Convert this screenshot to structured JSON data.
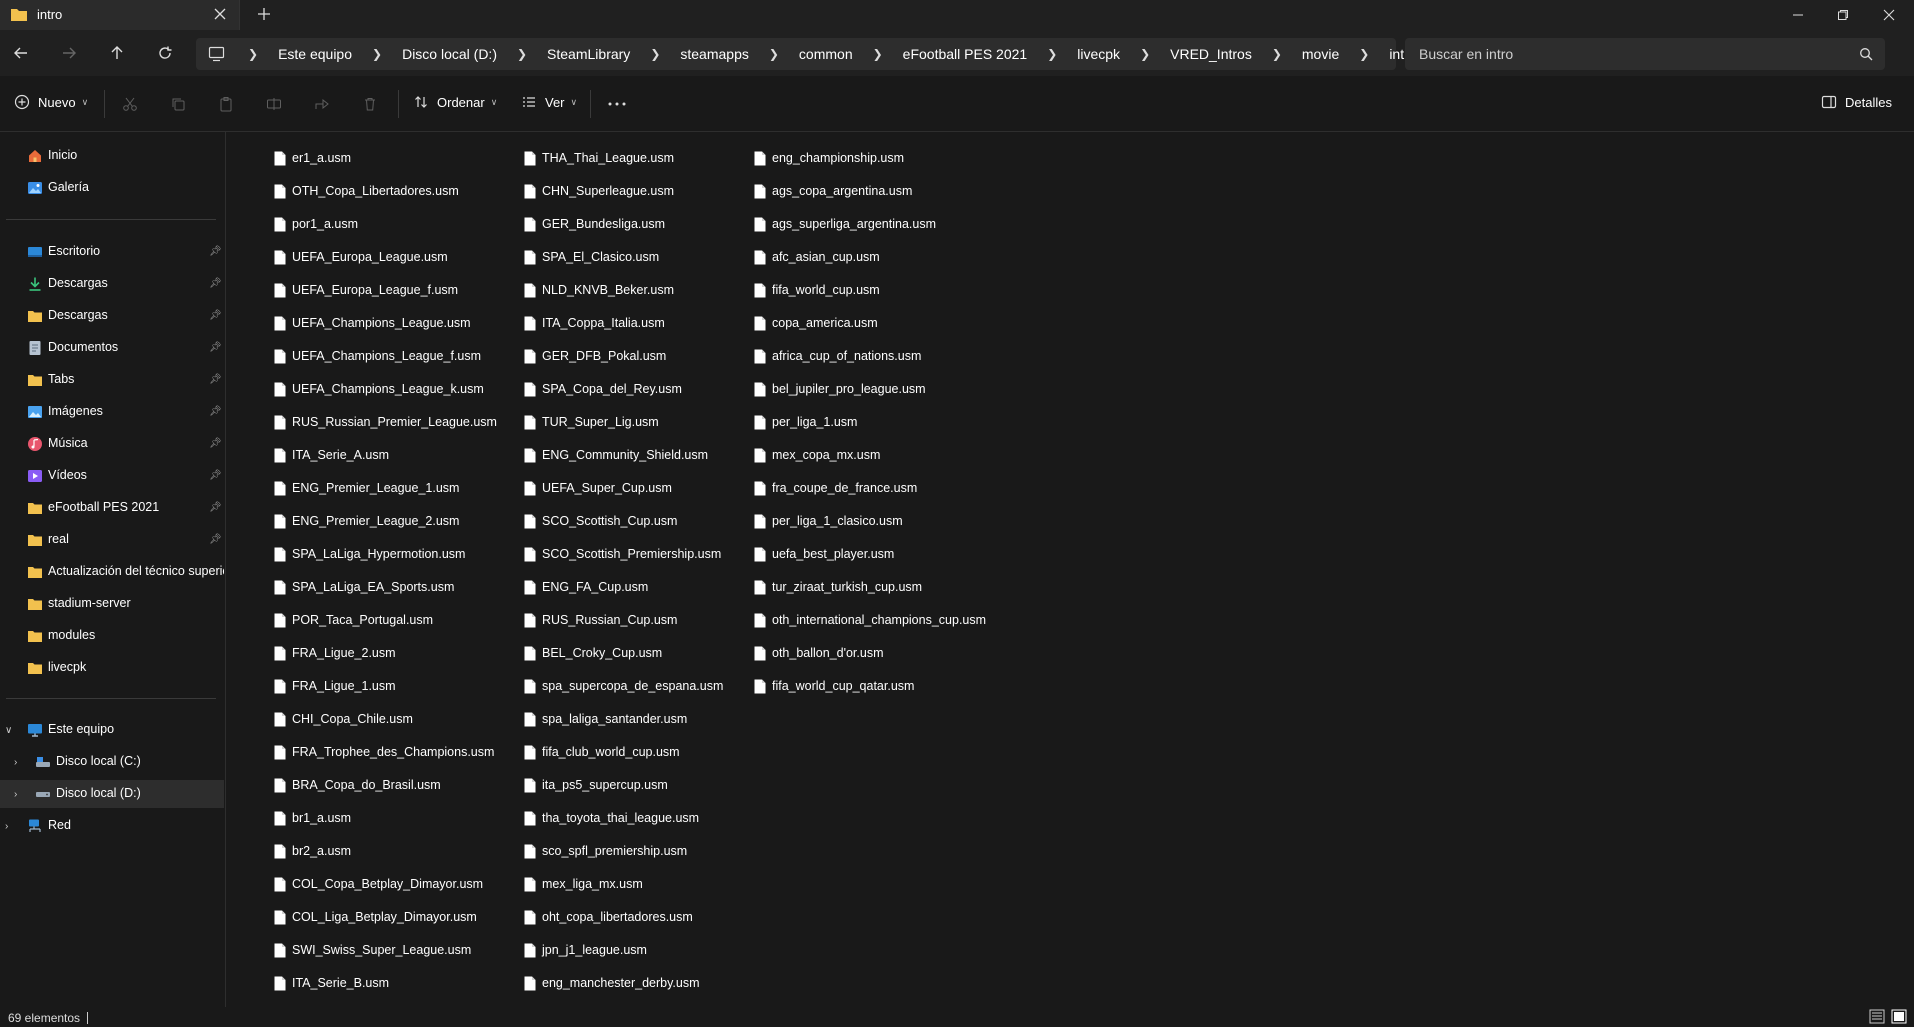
{
  "window": {
    "tab_title": "intro"
  },
  "address": {
    "breadcrumbs": [
      "Este equipo",
      "Disco local (D:)",
      "SteamLibrary",
      "steamapps",
      "common",
      "eFootball PES 2021",
      "livecpk",
      "VRED_Intros",
      "movie",
      "intro"
    ],
    "search_placeholder": "Buscar en intro"
  },
  "toolbar": {
    "new_label": "Nuevo",
    "sort_label": "Ordenar",
    "view_label": "Ver",
    "details_label": "Detalles"
  },
  "sidebar": {
    "home": "Inicio",
    "gallery": "Galería",
    "pinned": [
      "Escritorio",
      "Descargas",
      "Descargas",
      "Documentos",
      "Tabs",
      "Imágenes",
      "Música",
      "Vídeos",
      "eFootball PES 2021",
      "real"
    ],
    "recent": [
      "Actualización del técnico superio",
      "stadium-server",
      "modules",
      "livecpk"
    ],
    "this_pc": "Este equipo",
    "drive_c": "Disco local (C:)",
    "drive_d": "Disco local (D:)",
    "network": "Red"
  },
  "files": {
    "column1": [
      "er1_a.usm",
      "OTH_Copa_Libertadores.usm",
      "por1_a.usm",
      "UEFA_Europa_League.usm",
      "UEFA_Europa_League_f.usm",
      "UEFA_Champions_League.usm",
      "UEFA_Champions_League_f.usm",
      "UEFA_Champions_League_k.usm",
      "RUS_Russian_Premier_League.usm",
      "ITA_Serie_A.usm",
      "ENG_Premier_League_1.usm",
      "ENG_Premier_League_2.usm",
      "SPA_LaLiga_Hypermotion.usm",
      "SPA_LaLiga_EA_Sports.usm",
      "POR_Taca_Portugal.usm",
      "FRA_Ligue_2.usm",
      "FRA_Ligue_1.usm",
      "CHI_Copa_Chile.usm",
      "FRA_Trophee_des_Champions.usm",
      "BRA_Copa_do_Brasil.usm",
      "br1_a.usm",
      "br2_a.usm",
      "COL_Copa_Betplay_Dimayor.usm",
      "COL_Liga_Betplay_Dimayor.usm",
      "SWI_Swiss_Super_League.usm",
      "ITA_Serie_B.usm"
    ],
    "column2": [
      "THA_Thai_League.usm",
      "CHN_Superleague.usm",
      "GER_Bundesliga.usm",
      "SPA_El_Clasico.usm",
      "NLD_KNVB_Beker.usm",
      "ITA_Coppa_Italia.usm",
      "GER_DFB_Pokal.usm",
      "SPA_Copa_del_Rey.usm",
      "TUR_Super_Lig.usm",
      "ENG_Community_Shield.usm",
      "UEFA_Super_Cup.usm",
      "SCO_Scottish_Cup.usm",
      "SCO_Scottish_Premiership.usm",
      "ENG_FA_Cup.usm",
      "RUS_Russian_Cup.usm",
      "BEL_Croky_Cup.usm",
      "spa_supercopa_de_espana.usm",
      "spa_laliga_santander.usm",
      "fifa_club_world_cup.usm",
      "ita_ps5_supercup.usm",
      "tha_toyota_thai_league.usm",
      "sco_spfl_premiership.usm",
      "mex_liga_mx.usm",
      "oht_copa_libertadores.usm",
      "jpn_j1_league.usm",
      "eng_manchester_derby.usm"
    ],
    "column3": [
      "eng_championship.usm",
      "ags_copa_argentina.usm",
      "ags_superliga_argentina.usm",
      "afc_asian_cup.usm",
      "fifa_world_cup.usm",
      "copa_america.usm",
      "africa_cup_of_nations.usm",
      "bel_jupiler_pro_league.usm",
      "per_liga_1.usm",
      "mex_copa_mx.usm",
      "fra_coupe_de_france.usm",
      "per_liga_1_clasico.usm",
      "uefa_best_player.usm",
      "tur_ziraat_turkish_cup.usm",
      "oth_international_champions_cup.usm",
      "oth_ballon_d'or.usm",
      "fifa_world_cup_qatar.usm"
    ]
  },
  "status": {
    "count_text": "69 elementos"
  },
  "colors": {
    "background": "#191919",
    "chrome": "#202020",
    "field": "#2d2d2d",
    "folder": "#f2c14e",
    "selection": "#2d2d2d"
  }
}
